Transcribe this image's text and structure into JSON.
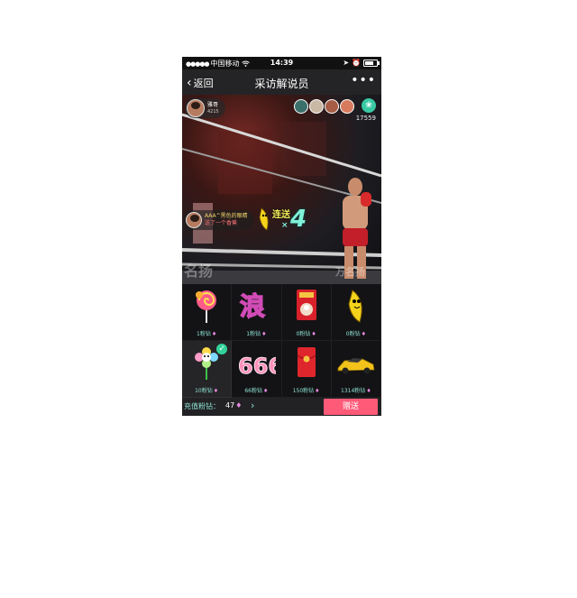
{
  "status_bar": {
    "carrier": "中国移动",
    "time": "14:39"
  },
  "nav": {
    "back_label": "返回",
    "title": "采访解说员",
    "more_icon": "more-icon"
  },
  "stream": {
    "host": {
      "name": "雅哥",
      "id": "4215"
    },
    "viewer_count": 4,
    "gem_count": "17559",
    "gift_toast": {
      "user": "AAA^黑色的眼睛",
      "message": "送了一个香蕉"
    },
    "combo_label": "连送",
    "combo_x": "×",
    "combo_count": "4",
    "watermarks": [
      "名扬",
      "万名扬"
    ]
  },
  "gifts": [
    {
      "icon": "lollipop-icon",
      "price": "1粉钻",
      "selected": false
    },
    {
      "icon": "word-art-icon",
      "price": "1粉钻",
      "selected": false
    },
    {
      "icon": "red-envelope-icon",
      "price": "0粉钻",
      "selected": false
    },
    {
      "icon": "banana-icon",
      "price": "0粉钻",
      "selected": false
    },
    {
      "icon": "flower-icon",
      "price": "10粉钻",
      "selected": true
    },
    {
      "icon": "number-666-icon",
      "price": "66粉钻",
      "selected": false
    },
    {
      "icon": "hongbao-icon",
      "price": "150粉钻",
      "selected": false
    },
    {
      "icon": "sports-car-icon",
      "price": "1314粉钻",
      "selected": false
    }
  ],
  "wallet": {
    "recharge_label": "充值粉钻：",
    "balance": "47"
  },
  "send_button": "赠送",
  "colors": {
    "accent": "#8ee0d2",
    "send": "#ff5a78",
    "diamond": "#e889e0"
  }
}
